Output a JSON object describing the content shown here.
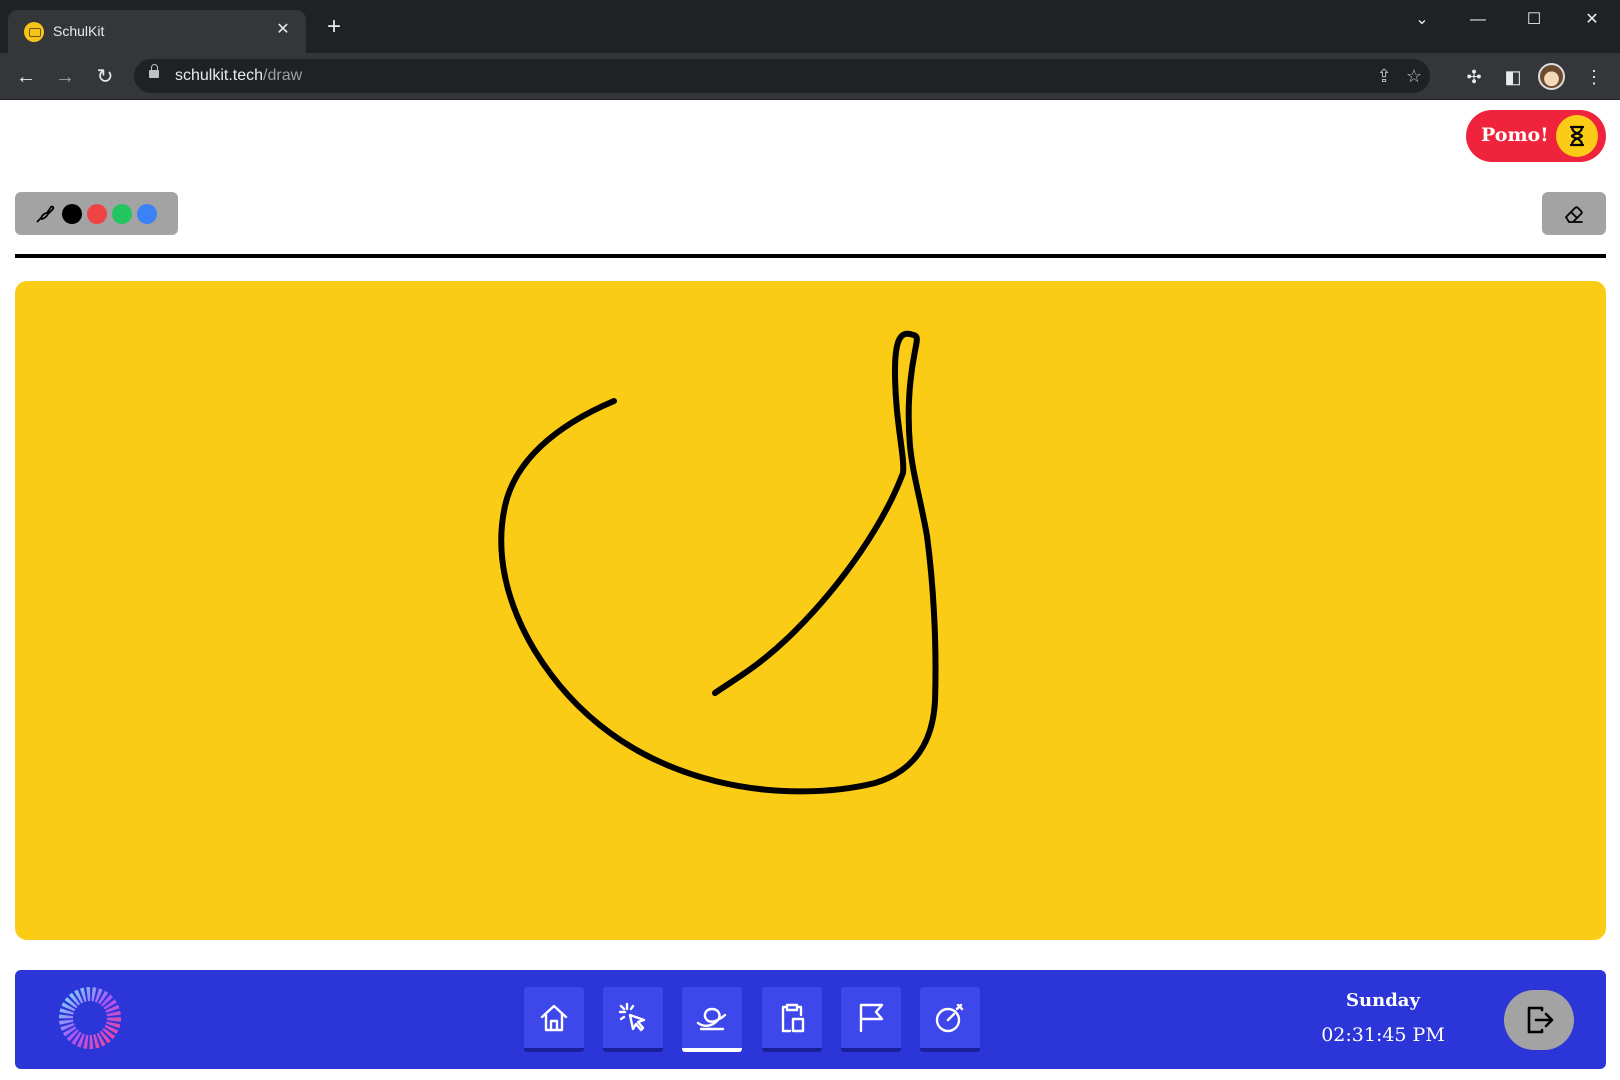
{
  "browser": {
    "tab_title": "SchulKit",
    "tab_close": "✕",
    "new_tab": "+",
    "url_host": "schulkit.tech",
    "url_path": "/draw",
    "window_controls": [
      "⌄",
      "—",
      "☐",
      "✕"
    ]
  },
  "header": {
    "pomo_label": "Pomo!"
  },
  "toolbar": {
    "swatches": [
      {
        "name": "black",
        "color": "#000000"
      },
      {
        "name": "red",
        "color": "#ef4444"
      },
      {
        "name": "green",
        "color": "#22c55e"
      },
      {
        "name": "blue",
        "color": "#3b82f6"
      }
    ]
  },
  "canvas": {
    "background": "#facc15",
    "stroke_color": "#000000"
  },
  "bottom_nav": {
    "items": [
      {
        "name": "home",
        "icon": "home-icon"
      },
      {
        "name": "click",
        "icon": "pointer-click-icon"
      },
      {
        "name": "draw",
        "icon": "scribble-icon",
        "active": true
      },
      {
        "name": "clipboard",
        "icon": "clipboard-icon"
      },
      {
        "name": "flag",
        "icon": "flag-icon"
      },
      {
        "name": "timer",
        "icon": "stopwatch-icon"
      }
    ],
    "day": "Sunday",
    "time": "02:31:45 PM"
  },
  "colors": {
    "brand_blue": "#2c35d8",
    "pomo_red": "#ef233c",
    "accent_yellow": "#facc15"
  }
}
